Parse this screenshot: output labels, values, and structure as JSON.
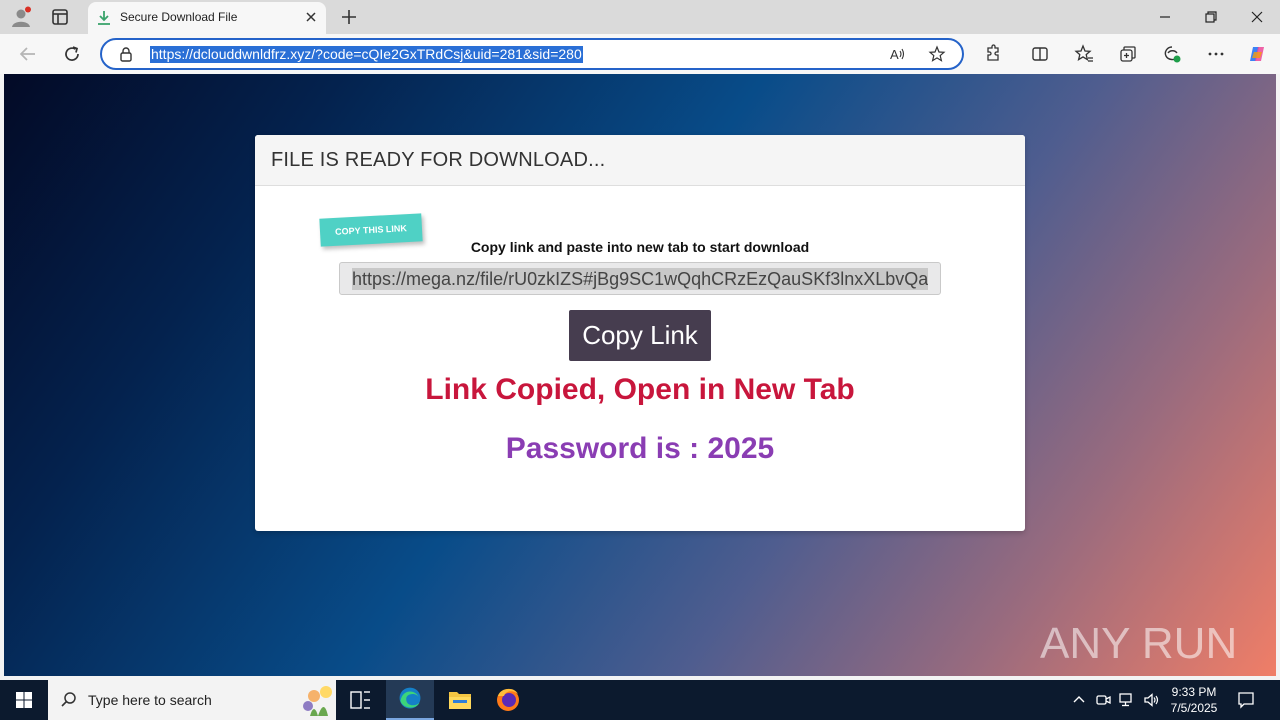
{
  "browser": {
    "tab_title": "Secure Download File",
    "url": "https://dclouddwnldfrz.xyz/?code=cQIe2GxTRdCsj&uid=281&sid=280",
    "accent": "#2a6fd6"
  },
  "page": {
    "header": "FILE IS READY FOR DOWNLOAD...",
    "ribbon": "COPY THIS LINK",
    "instruction": "Copy link and paste into new tab to start download",
    "link_value": "https://mega.nz/file/rU0zkIZS#jBg9SC1wQqhCRzEzQauSKf3lnxXLbvQa",
    "copy_button": "Copy Link",
    "copied_message": "Link Copied, Open in New Tab",
    "password_message": "Password is : 2025",
    "colors": {
      "copied": "#c8163c",
      "password": "#8a3db3",
      "button": "#463d4f",
      "ribbon": "#4fd1c5"
    }
  },
  "watermark": "ANY RUN",
  "taskbar": {
    "search_placeholder": "Type here to search",
    "time": "9:33 PM",
    "date": "7/5/2025"
  }
}
